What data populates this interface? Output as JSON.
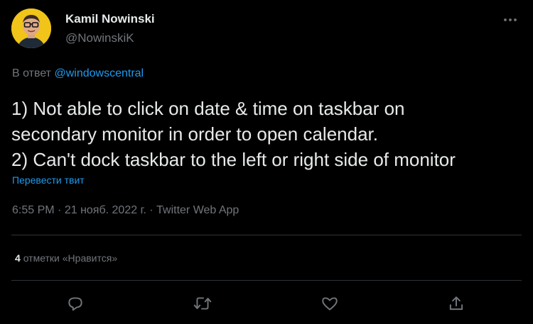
{
  "author": {
    "name": "Kamil Nowinski",
    "handle": "@NowinskiK"
  },
  "reply": {
    "prefix": "В ответ",
    "mention": "@windowscentral"
  },
  "tweet": {
    "lines": [
      "1) Not able to click on date & time on taskbar on",
      "secondary monitor in order to open calendar.",
      "2) Can't dock taskbar to the left or right side of monitor"
    ]
  },
  "translate_label": "Перевести твит",
  "meta": {
    "time": "6:55 PM",
    "date": "21 нояб. 2022 г.",
    "source": "Twitter Web App",
    "separator": "·"
  },
  "likes": {
    "count": "4",
    "label": "отметки «Нравится»"
  },
  "icons": {
    "more": "more-dots-icon",
    "reply": "reply-bubble-icon",
    "retweet": "retweet-icon",
    "like": "heart-icon",
    "share": "share-upload-icon"
  },
  "colors": {
    "background": "#000000",
    "primary_text": "#e7e9ea",
    "secondary_text": "#71767b",
    "link": "#1d9bf0",
    "divider": "#2f3336",
    "avatar_bg": "#f0c419"
  }
}
